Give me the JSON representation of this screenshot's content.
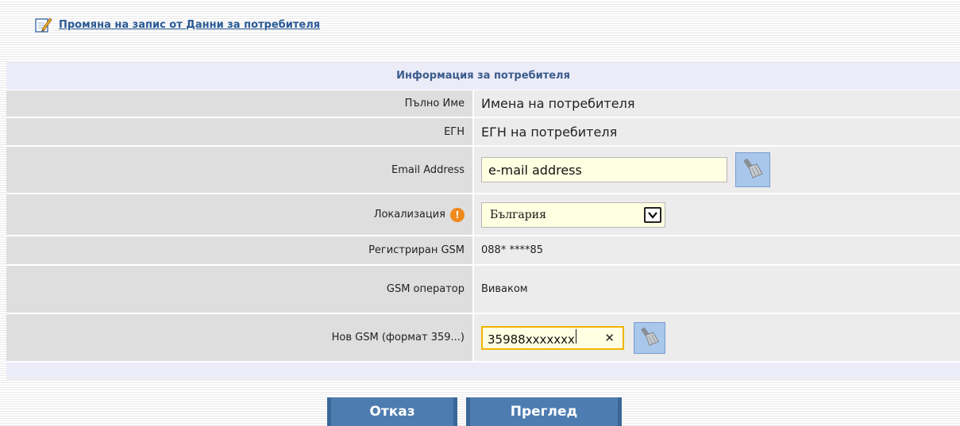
{
  "header": {
    "link_text": "Промяна на запис от Данни за потребителя",
    "icon": "edit-note-icon"
  },
  "panel": {
    "title": "Информация за потребителя",
    "rows": [
      {
        "label": "Пълно Име",
        "value": "Имена на потребителя"
      },
      {
        "label": "ЕГН",
        "value": "ЕГН на потребителя"
      },
      {
        "label": "Email Address",
        "value": "e-mail address"
      },
      {
        "label": "Локализация",
        "value": "България"
      },
      {
        "label": "Регистриран GSM",
        "value": "088* ****85"
      },
      {
        "label": "GSM оператор",
        "value": "Виваком"
      },
      {
        "label": "Нов GSM (формат 359...)",
        "value": "35988xxxxxxx"
      }
    ]
  },
  "icons": {
    "clear": "broom-icon",
    "warning": "warning-icon",
    "dropdown": "chevron-down-icon"
  },
  "buttons": {
    "cancel": "Отказ",
    "preview": "Преглед"
  },
  "colors": {
    "link": "#2a5a96",
    "title": "#3a5c8c",
    "button": "#4d7cb0",
    "input_bg": "#ffffe1",
    "focus_border": "#f0b400"
  }
}
